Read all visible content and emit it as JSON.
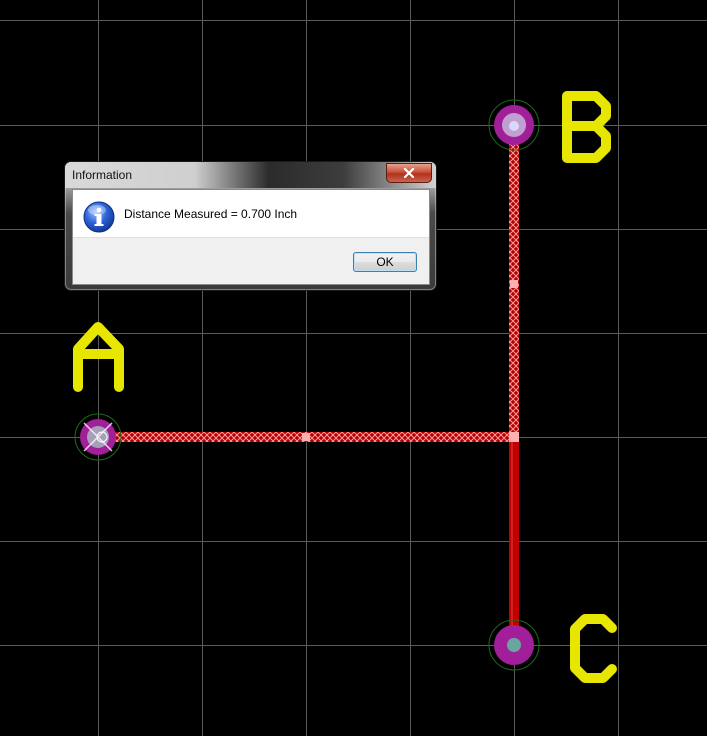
{
  "app": {
    "colors": {
      "background": "#000000",
      "grid": "#5a5a5a",
      "silkscreen": "#e6e600",
      "track": "#cc0000",
      "highlight": "#ff9a9a",
      "pad_ring": "#cc44cc",
      "pad_hole": "#6aa6a0"
    }
  },
  "board": {
    "labels": {
      "a": "A",
      "b": "B",
      "c": "C"
    }
  },
  "dialog": {
    "title": "Information",
    "message": "Distance Measured = 0.700 Inch",
    "ok_label": "OK",
    "icon": "info-icon",
    "close_icon": "close-icon"
  }
}
